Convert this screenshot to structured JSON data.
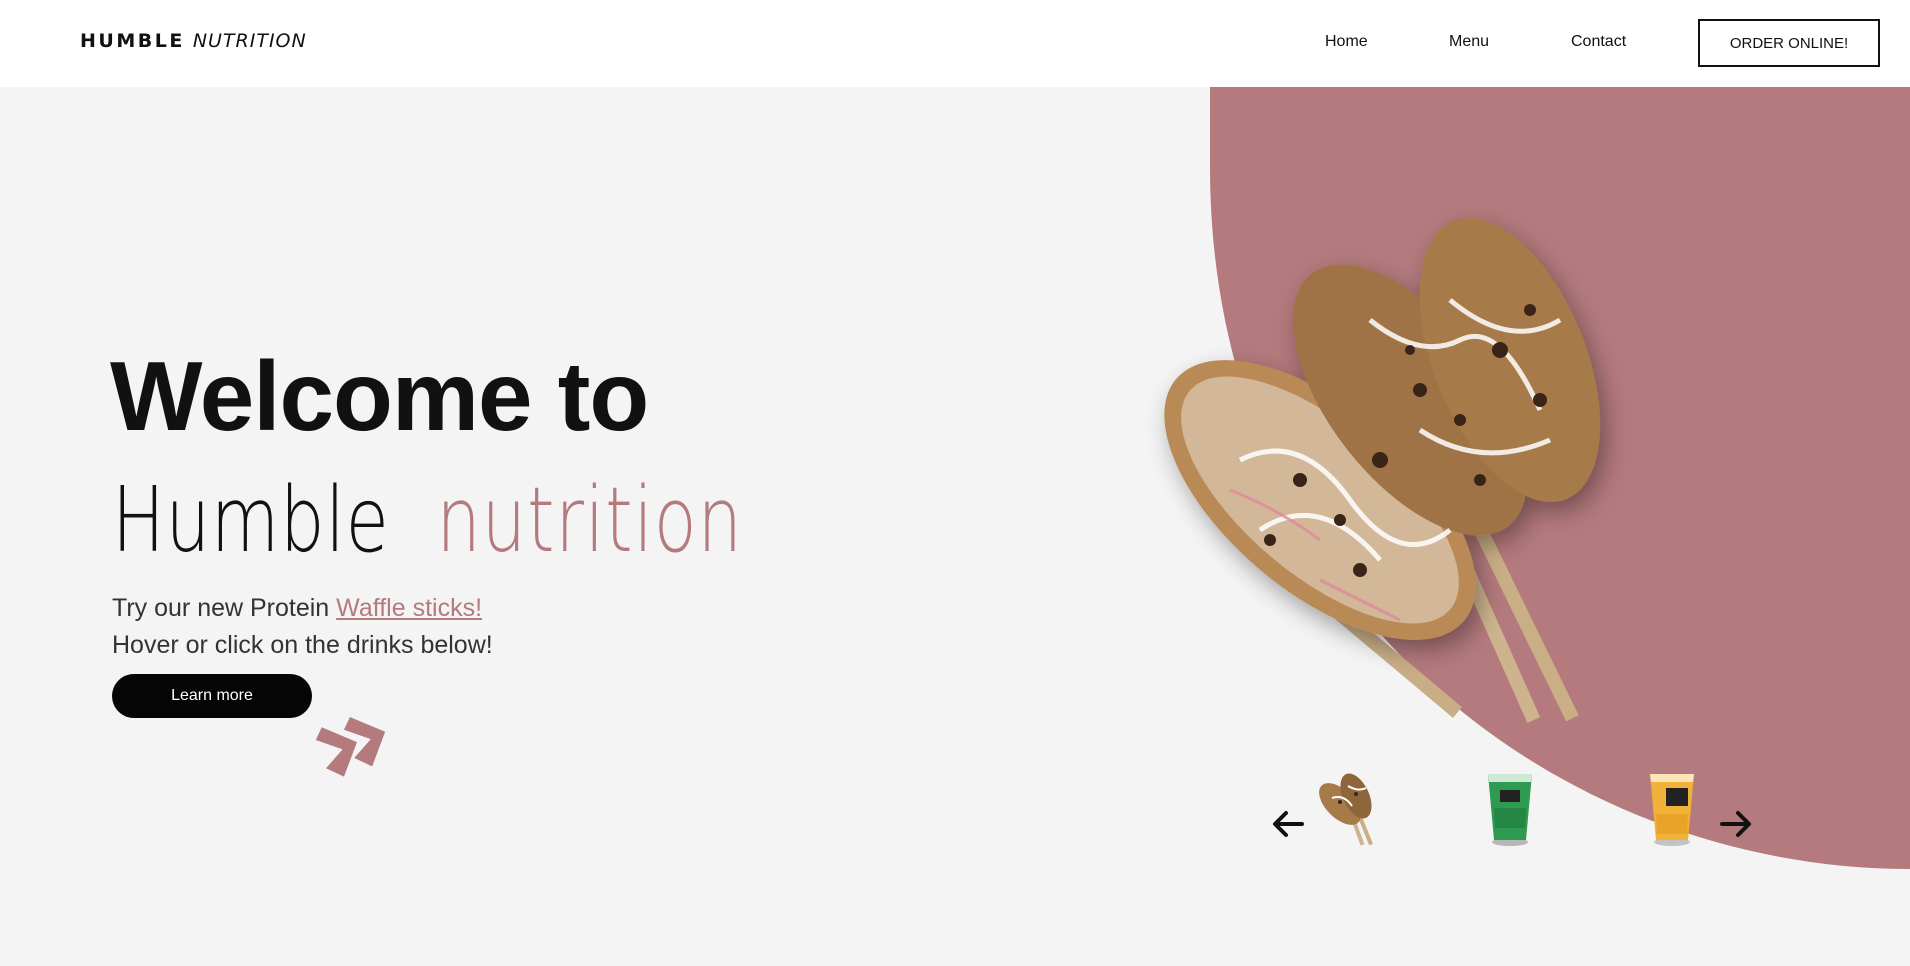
{
  "header": {
    "logo_bold": "HUMBLE",
    "logo_thin": "NUTRITION",
    "nav": {
      "home": "Home",
      "menu": "Menu",
      "contact": "Contact"
    },
    "order_button": "ORDER ONLINE!"
  },
  "hero": {
    "title": "Welcome to",
    "script_word1": "Humble",
    "script_word2": "nutrition",
    "line1_prefix": "Try our new Protein ",
    "line1_link": "Waffle sticks!",
    "line2": "Hover or click on the drinks below!",
    "learn_button": "Learn more"
  },
  "carousel": {
    "items": [
      {
        "name": "waffle-sticks"
      },
      {
        "name": "green-drink"
      },
      {
        "name": "orange-drink"
      }
    ]
  },
  "colors": {
    "accent": "#b47a7d",
    "background": "#f4f4f4",
    "header_bg": "#ffffff",
    "button_bg": "#050505"
  }
}
